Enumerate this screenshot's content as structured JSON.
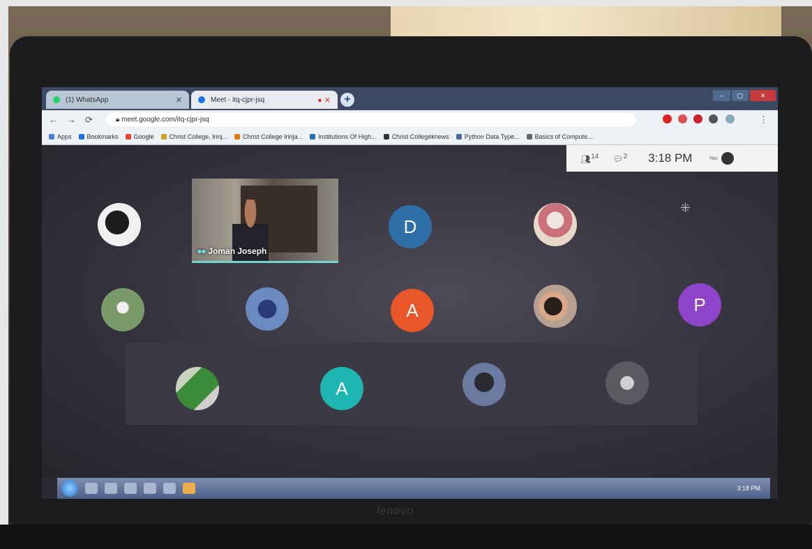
{
  "browser": {
    "tabs": [
      {
        "label": "(1) WhatsApp",
        "icon": "whatsapp-icon",
        "color": "#25d366"
      },
      {
        "label": "Meet - itq-cjpr-jsq",
        "icon": "meet-icon",
        "color": "#1a73e8"
      }
    ],
    "url": "meet.google.com/itq-cjpr-jsq",
    "bookmarks": [
      "Apps",
      "Bookmarks",
      "Google",
      "Christ College, Irinj...",
      "Christ College Irinja...",
      "Institutions Of High...",
      "Christ Collegeknews",
      "Python Data Type...",
      "Basics of Compute..."
    ]
  },
  "meet": {
    "participants_count": "14",
    "chat_count": "2",
    "time": "3:18 PM",
    "self_label": "You",
    "video_name": "Joman Joseph",
    "participants": [
      {
        "type": "photo",
        "color": "#e8e8e8"
      },
      {
        "type": "letter",
        "letter": "D",
        "color": "#2f6fa8"
      },
      {
        "type": "photo",
        "color": "#c9a08a"
      },
      {
        "type": "photo",
        "color": "#7a9a6a"
      },
      {
        "type": "photo",
        "color": "#4a6aa8"
      },
      {
        "type": "letter",
        "letter": "A",
        "color": "#e8562a"
      },
      {
        "type": "photo",
        "color": "#b08a78"
      },
      {
        "type": "letter",
        "letter": "P",
        "color": "#8e44c8"
      },
      {
        "type": "photo",
        "color": "#8aa06a"
      },
      {
        "type": "letter",
        "letter": "A",
        "color": "#1fb5b0"
      },
      {
        "type": "photo",
        "color": "#6a7aa0"
      },
      {
        "type": "photo",
        "color": "#5a5a60"
      }
    ]
  },
  "taskbar": {
    "clock": "3:18 PM"
  },
  "laptop": {
    "brand": "lenovo"
  }
}
